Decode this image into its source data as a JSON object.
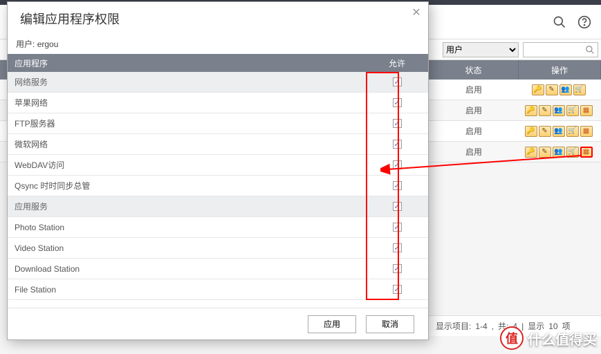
{
  "bg": {
    "filter": {
      "selected": "用户"
    },
    "columns": {
      "status": "状态",
      "actions": "操作"
    },
    "rows": [
      {
        "status": "启用",
        "icons": [
          "key",
          "edit",
          "users",
          "cart"
        ],
        "highlight_last": false
      },
      {
        "status": "启用",
        "icons": [
          "key",
          "edit",
          "users",
          "cart",
          "grid"
        ],
        "highlight_last": false
      },
      {
        "status": "启用",
        "icons": [
          "key",
          "edit",
          "users",
          "cart",
          "grid"
        ],
        "highlight_last": false
      },
      {
        "status": "启用",
        "icons": [
          "key",
          "edit",
          "users",
          "cart",
          "grid"
        ],
        "highlight_last": true
      }
    ],
    "footer": {
      "label1": "显示项目:",
      "range": "1-4",
      "label2": "共:",
      "total": "4",
      "label3": "显示",
      "per": "10",
      "label4": "项"
    }
  },
  "modal": {
    "title": "编辑应用程序权限",
    "user_label": "用户:",
    "user_name": "ergou",
    "columns": {
      "app": "应用程序",
      "allow": "允许"
    },
    "rows": [
      {
        "type": "group",
        "label": "网络服务",
        "checked": true
      },
      {
        "type": "item",
        "label": "苹果网络",
        "checked": true
      },
      {
        "type": "item",
        "label": "FTP服务器",
        "checked": true
      },
      {
        "type": "item",
        "label": "微软网络",
        "checked": true
      },
      {
        "type": "item",
        "label": "WebDAV访问",
        "checked": true
      },
      {
        "type": "item",
        "label": "Qsync 时时同步总管",
        "checked": true
      },
      {
        "type": "group",
        "label": "应用服务",
        "checked": true
      },
      {
        "type": "item",
        "label": "Photo Station",
        "checked": true
      },
      {
        "type": "item",
        "label": "Video Station",
        "checked": true
      },
      {
        "type": "item",
        "label": "Download Station",
        "checked": true
      },
      {
        "type": "item",
        "label": "File Station",
        "checked": true
      }
    ],
    "buttons": {
      "apply": "应用",
      "cancel": "取消"
    }
  },
  "watermark": {
    "char": "值",
    "text": "什么值得买"
  },
  "icons": {
    "key": "🔑",
    "edit": "✎",
    "users": "👥",
    "cart": "🛒",
    "grid": "▦",
    "search": "search",
    "help": "help"
  }
}
